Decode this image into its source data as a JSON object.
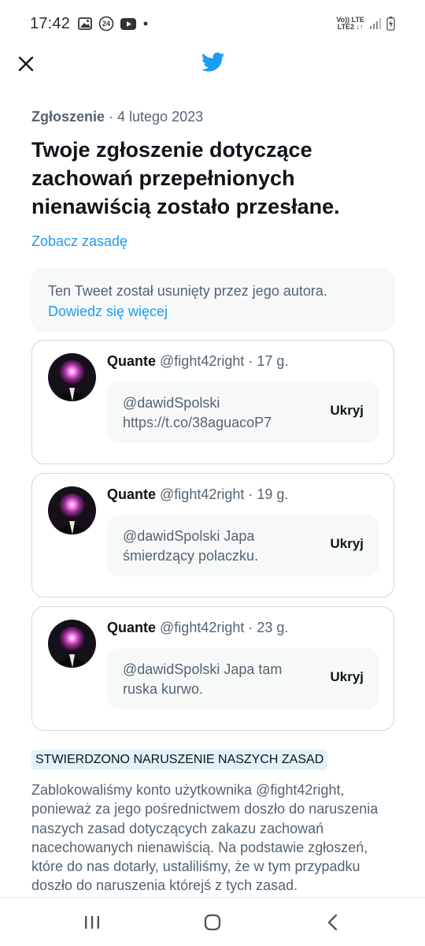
{
  "status_bar": {
    "time": "17:42",
    "notification_count": "24",
    "network_top": "Vo)) LTE",
    "network_bottom": "LTE2 ↓↑"
  },
  "header": {
    "close_icon": "close-icon",
    "logo_icon": "twitter-bird-icon",
    "accent_color": "#1d9bf0"
  },
  "report": {
    "label": "Zgłoszenie",
    "separator": " · ",
    "date": "4 lutego 2023",
    "headline": "Twoje zgłoszenie dotyczące zachowań przepełnionych nienawiścią zostało przesłane.",
    "policy_link": "Zobacz zasadę"
  },
  "deleted_notice": {
    "text": "Ten Tweet został usunięty przez jego autora.",
    "link": "Dowiedz się więcej"
  },
  "tweets": [
    {
      "name": "Quante",
      "handle": "@fight42right",
      "age": "17 g.",
      "text": "@dawidSpolski https://t.co/38aguacoP7",
      "hide_label": "Ukryj"
    },
    {
      "name": "Quante",
      "handle": "@fight42right",
      "age": "19 g.",
      "text": "@dawidSpolski Japa śmierdzący polaczku.",
      "hide_label": "Ukryj"
    },
    {
      "name": "Quante",
      "handle": "@fight42right",
      "age": "23 g.",
      "text": "@dawidSpolski Japa tam ruska kurwo.",
      "hide_label": "Ukryj"
    }
  ],
  "violation": {
    "badge": "STWIERDZONO NARUSZENIE NASZYCH ZASAD",
    "explanation": "Zablokowaliśmy konto użytkownika @fight42right, ponieważ za jego pośrednictwem doszło do naruszenia naszych zasad dotyczących zakazu zachowań nacechowanych nienawiścią. Na podstawie zgłoszeń, które do nas dotarły, ustaliliśmy, że w tym przypadku doszło do naruszenia którejś z tych zasad."
  },
  "nav_bar": {
    "recents_icon": "recents-icon",
    "home_icon": "home-icon",
    "back_icon": "back-icon"
  }
}
